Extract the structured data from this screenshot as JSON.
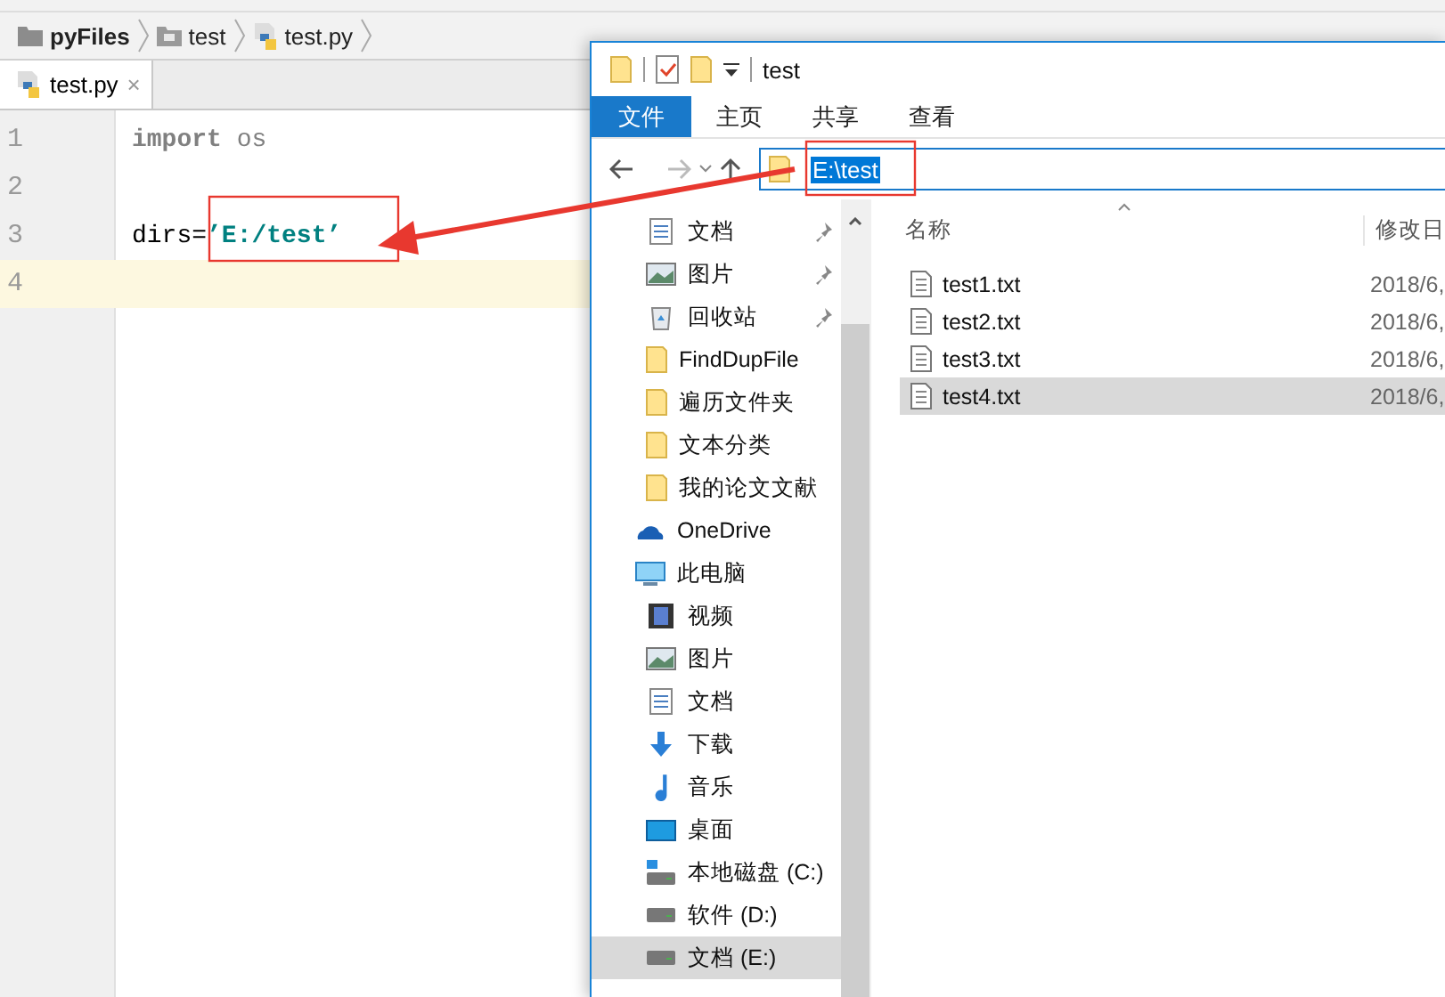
{
  "ide": {
    "breadcrumb": [
      {
        "label": "pyFiles",
        "kind": "project"
      },
      {
        "label": "test",
        "kind": "folder"
      },
      {
        "label": "test.py",
        "kind": "python"
      }
    ],
    "tabs": [
      {
        "label": "test.py",
        "close": "×",
        "selected": true
      }
    ],
    "lines": [
      {
        "number": "1",
        "current": false,
        "tokens": [
          {
            "text": "import",
            "kind": "keyword"
          },
          {
            "text": " os",
            "kind": "unused"
          }
        ]
      },
      {
        "number": "2",
        "current": false
      },
      {
        "number": "3",
        "current": false,
        "tokens": [
          {
            "text": "dirs=",
            "kind": "plain"
          },
          {
            "text": "’E:/test’",
            "kind": "string"
          }
        ]
      },
      {
        "number": "4",
        "current": true
      }
    ]
  },
  "explorer": {
    "title": "test",
    "ribbon_tabs": [
      {
        "label": "文件",
        "selected": true
      },
      {
        "label": "主页",
        "selected": false
      },
      {
        "label": "共享",
        "selected": false
      },
      {
        "label": "查看",
        "selected": false
      }
    ],
    "address": "E:\\test",
    "nav": [
      {
        "label": "文档",
        "kind": "doc",
        "pinned": true,
        "selected": false,
        "top": false
      },
      {
        "label": "图片",
        "kind": "pictures",
        "pinned": true,
        "selected": false,
        "top": false
      },
      {
        "label": "回收站",
        "kind": "recycle",
        "pinned": true,
        "selected": false,
        "top": false
      },
      {
        "label": "FindDupFile",
        "kind": "folder",
        "pinned": false,
        "selected": false,
        "top": false
      },
      {
        "label": "遍历文件夹",
        "kind": "folder",
        "pinned": false,
        "selected": false,
        "top": false
      },
      {
        "label": "文本分类",
        "kind": "folder",
        "pinned": false,
        "selected": false,
        "top": false
      },
      {
        "label": "我的论文文献",
        "kind": "folder",
        "pinned": false,
        "selected": false,
        "top": false
      },
      {
        "label": "OneDrive",
        "kind": "cloud",
        "pinned": false,
        "selected": false,
        "top": true
      },
      {
        "label": "此电脑",
        "kind": "pc",
        "pinned": false,
        "selected": false,
        "top": true
      },
      {
        "label": "视频",
        "kind": "video",
        "pinned": false,
        "selected": false,
        "top": false
      },
      {
        "label": "图片",
        "kind": "pictures",
        "pinned": false,
        "selected": false,
        "top": false
      },
      {
        "label": "文档",
        "kind": "doc",
        "pinned": false,
        "selected": false,
        "top": false
      },
      {
        "label": "下载",
        "kind": "download",
        "pinned": false,
        "selected": false,
        "top": false
      },
      {
        "label": "音乐",
        "kind": "music",
        "pinned": false,
        "selected": false,
        "top": false
      },
      {
        "label": "桌面",
        "kind": "desktop",
        "pinned": false,
        "selected": false,
        "top": false
      },
      {
        "label": "本地磁盘 (C:)",
        "kind": "sysdrive",
        "pinned": false,
        "selected": false,
        "top": false
      },
      {
        "label": "软件 (D:)",
        "kind": "drive",
        "pinned": false,
        "selected": false,
        "top": false
      },
      {
        "label": "文档 (E:)",
        "kind": "drive",
        "pinned": false,
        "selected": true,
        "top": false
      }
    ],
    "columns": [
      "名称",
      "修改日"
    ],
    "files": [
      {
        "name": "test1.txt",
        "modified": "2018/6,",
        "selected": false
      },
      {
        "name": "test2.txt",
        "modified": "2018/6,",
        "selected": false
      },
      {
        "name": "test3.txt",
        "modified": "2018/6,",
        "selected": false
      },
      {
        "name": "test4.txt",
        "modified": "2018/6,",
        "selected": true
      }
    ]
  }
}
